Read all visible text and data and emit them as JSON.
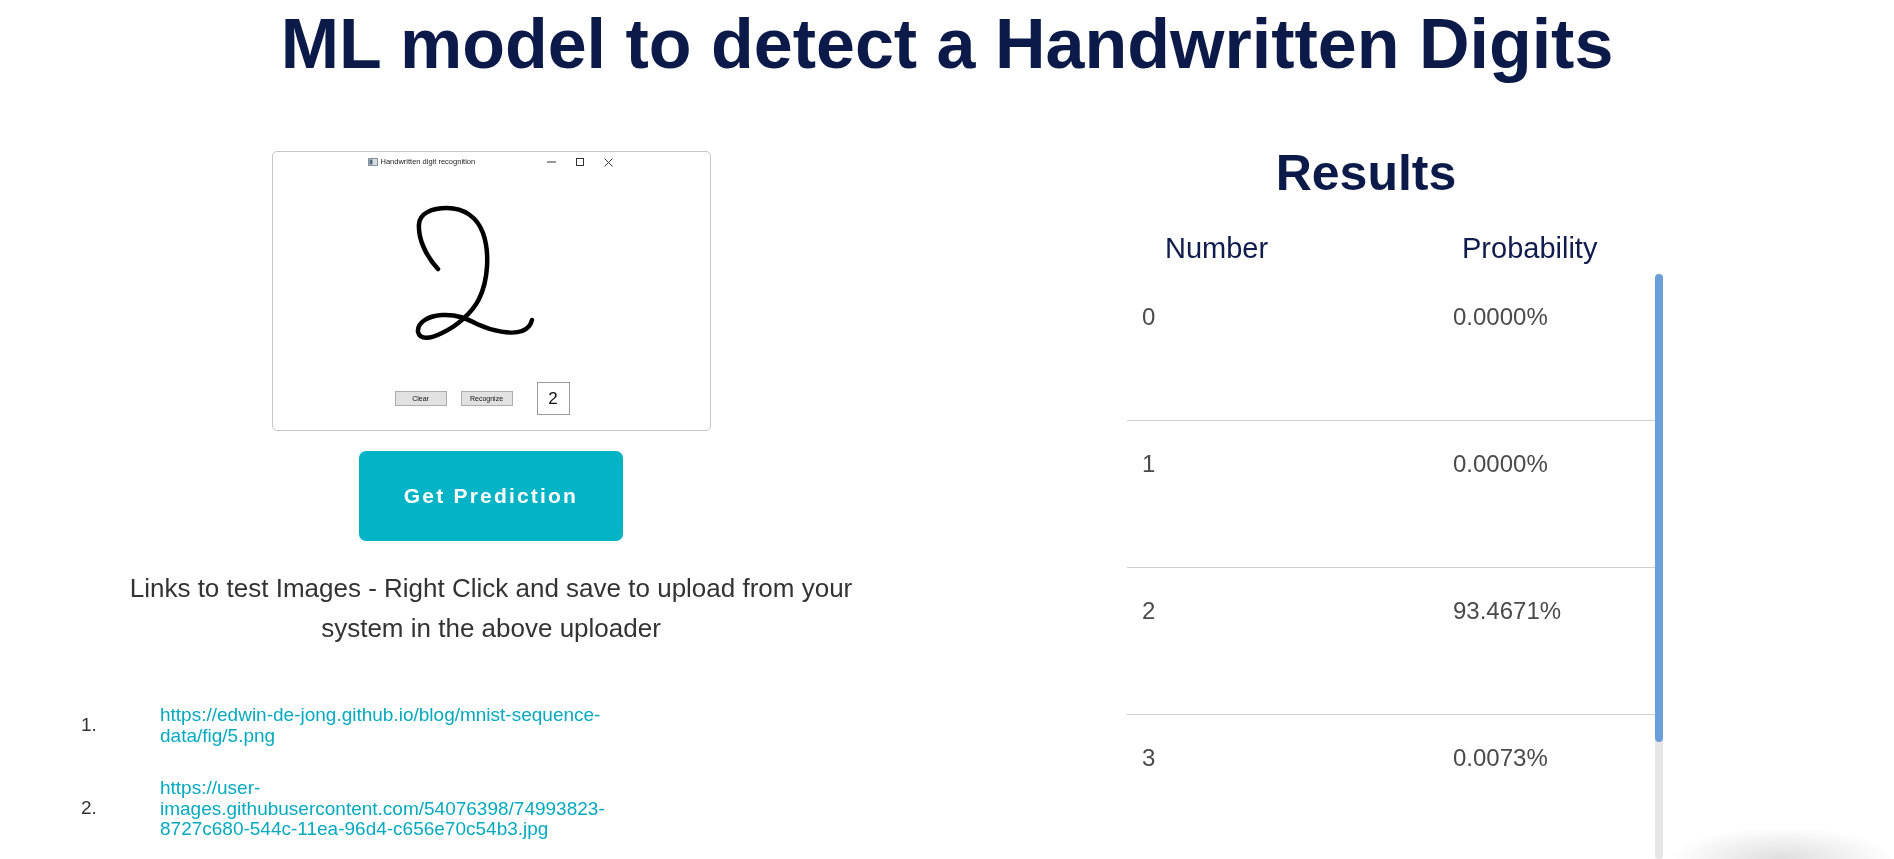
{
  "page": {
    "title": "ML model to detect a Handwritten Digits"
  },
  "app_window": {
    "title": "Handwritten digit recognition",
    "buttons": [
      "Clear",
      "Recognize"
    ],
    "result": "2"
  },
  "predict_button": {
    "label": "Get Prediction"
  },
  "instructions": "Links to test Images - Right Click and save to upload from your system in the above uploader",
  "test_links": [
    {
      "number": "1.",
      "url": "https://edwin-de-jong.github.io/blog/mnist-sequence-data/fig/5.png"
    },
    {
      "number": "2.",
      "url": "https://user-images.githubusercontent.com/54076398/74993823-8727c680-544c-11ea-96d4-c656e70c54b3.jpg"
    }
  ],
  "results": {
    "title": "Results",
    "columns": [
      "Number",
      "Probability"
    ],
    "rows": [
      {
        "number": "0",
        "probability": "0.0000%"
      },
      {
        "number": "1",
        "probability": "0.0000%"
      },
      {
        "number": "2",
        "probability": "93.4671%"
      },
      {
        "number": "3",
        "probability": "0.0073%"
      }
    ]
  }
}
